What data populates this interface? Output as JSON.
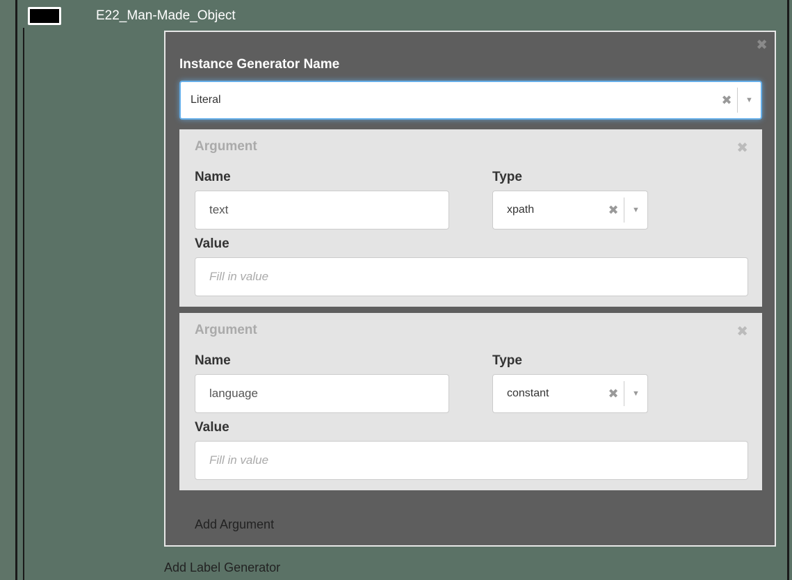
{
  "header": {
    "class_name": "E22_Man-Made_Object"
  },
  "instance_generator": {
    "label": "Instance Generator Name",
    "selected": "Literal",
    "clear_icon": "close-icon",
    "arrow_icon": "chevron-down-icon"
  },
  "arguments": [
    {
      "title": "Argument",
      "name_label": "Name",
      "name_value": "text",
      "type_label": "Type",
      "type_value": "xpath",
      "value_label": "Value",
      "value_placeholder": "Fill in value"
    },
    {
      "title": "Argument",
      "name_label": "Name",
      "name_value": "language",
      "type_label": "Type",
      "type_value": "constant",
      "value_label": "Value",
      "value_placeholder": "Fill in value"
    }
  ],
  "add_argument_label": "Add Argument",
  "add_label_generator_label": "Add Label Generator",
  "colors": {
    "background": "#5b7266",
    "panel": "#5e5e5e",
    "card": "#e4e4e4",
    "focus": "#66afe9"
  }
}
